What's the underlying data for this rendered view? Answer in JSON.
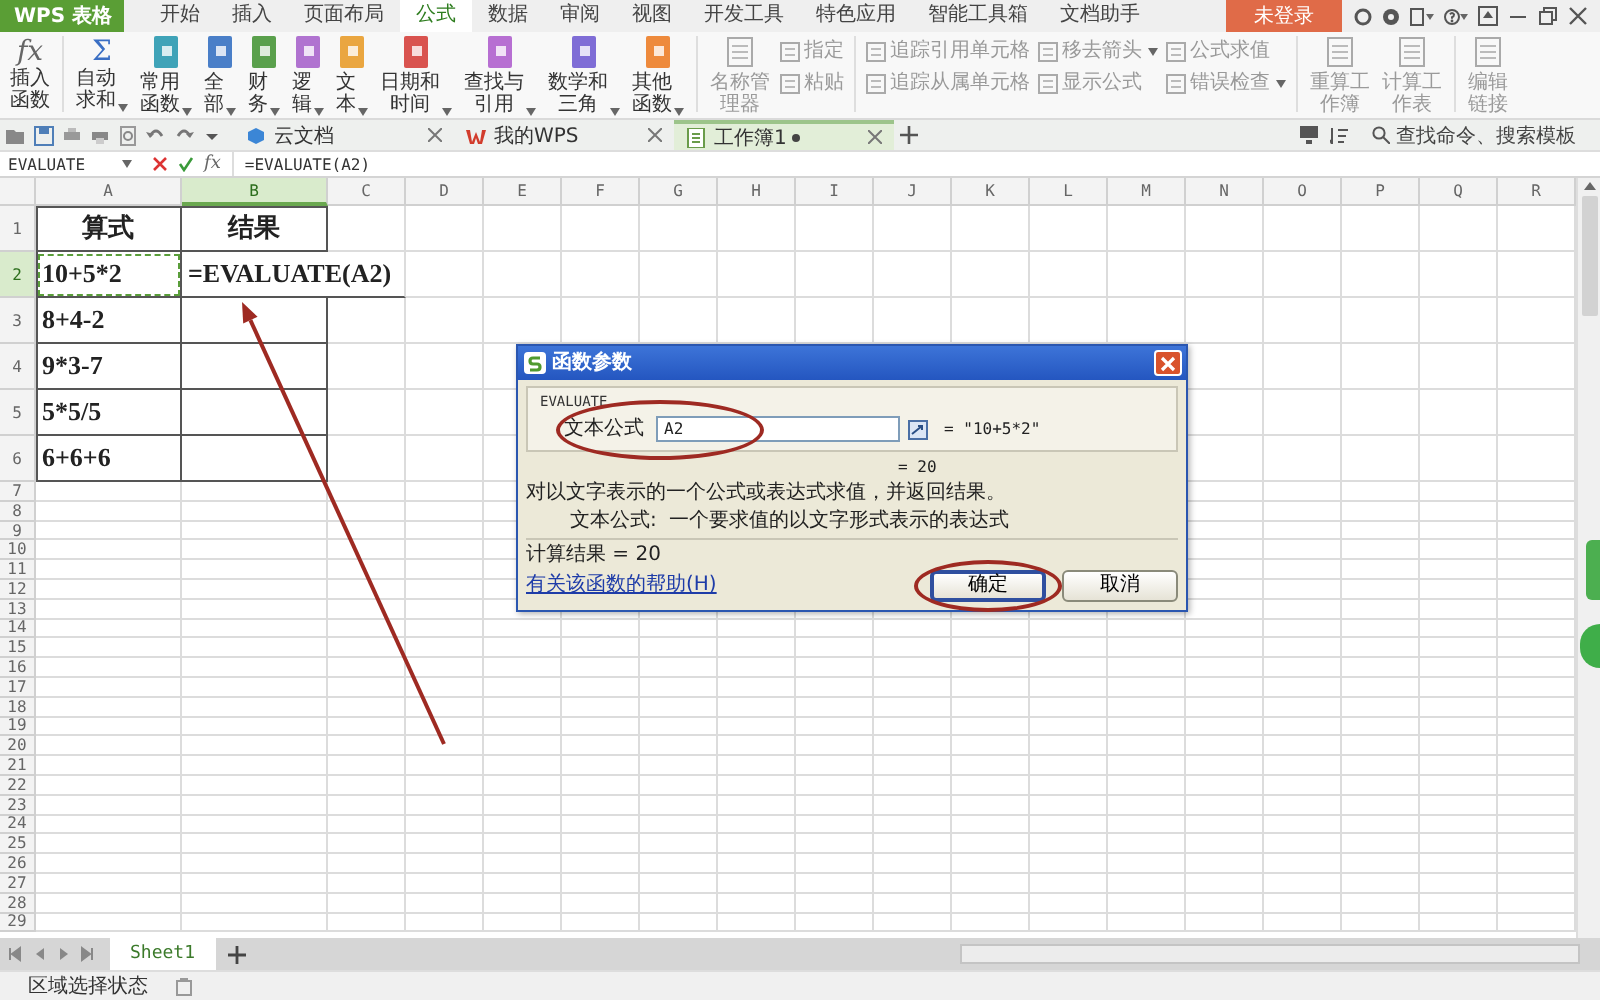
{
  "app": {
    "logo": "WPS 表格"
  },
  "menu_tabs": [
    {
      "label": "开始",
      "selected": false
    },
    {
      "label": "插入",
      "selected": false
    },
    {
      "label": "页面布局",
      "selected": false
    },
    {
      "label": "公式",
      "selected": true
    },
    {
      "label": "数据",
      "selected": false
    },
    {
      "label": "审阅",
      "selected": false
    },
    {
      "label": "视图",
      "selected": false
    },
    {
      "label": "开发工具",
      "selected": false
    },
    {
      "label": "特色应用",
      "selected": false
    },
    {
      "label": "智能工具箱",
      "selected": false
    },
    {
      "label": "文档助手",
      "selected": false
    }
  ],
  "login_button": "未登录",
  "ribbon": {
    "items": [
      {
        "kind": "glyph",
        "icon_text": "fx",
        "label": "插入函数",
        "dropdown": false,
        "disabled": false
      },
      {
        "kind": "separator"
      },
      {
        "kind": "glyph",
        "icon_text": "Σ",
        "label": "自动求和",
        "dropdown": true,
        "disabled": false
      },
      {
        "kind": "book",
        "color": "#3fa3b8",
        "label": "常用函数",
        "dropdown": true,
        "disabled": false
      },
      {
        "kind": "book",
        "color": "#4a7fc8",
        "label": "全部",
        "dropdown": true,
        "disabled": false
      },
      {
        "kind": "book",
        "color": "#5aa04c",
        "label": "财务",
        "dropdown": true,
        "disabled": false
      },
      {
        "kind": "book",
        "color": "#b073d0",
        "label": "逻辑",
        "dropdown": true,
        "disabled": false
      },
      {
        "kind": "book",
        "color": "#eaa640",
        "label": "文本",
        "dropdown": true,
        "disabled": false
      },
      {
        "kind": "book",
        "color": "#d9534f",
        "label": "日期和时间",
        "dropdown": true,
        "disabled": false
      },
      {
        "kind": "book",
        "color": "#b76fd2",
        "label": "查找与引用",
        "dropdown": true,
        "disabled": false
      },
      {
        "kind": "book",
        "color": "#7f6dd6",
        "label": "数学和三角",
        "dropdown": true,
        "disabled": false
      },
      {
        "kind": "book",
        "color": "#ee8a3c",
        "label": "其他函数",
        "dropdown": true,
        "disabled": false
      },
      {
        "kind": "separator"
      },
      {
        "kind": "tool",
        "label": "名称管理器",
        "dropdown": false,
        "disabled": true
      },
      {
        "kind": "stack",
        "disabled": true,
        "buttons": [
          {
            "label": "指定",
            "dropdown": false
          },
          {
            "label": "粘贴",
            "dropdown": false
          }
        ]
      },
      {
        "kind": "separator"
      },
      {
        "kind": "stack",
        "disabled": true,
        "buttons": [
          {
            "label": "追踪引用单元格",
            "dropdown": false
          },
          {
            "label": "追踪从属单元格",
            "dropdown": false
          }
        ]
      },
      {
        "kind": "stack",
        "disabled": true,
        "buttons": [
          {
            "label": "移去箭头",
            "dropdown": true
          },
          {
            "label": "显示公式",
            "dropdown": false
          }
        ]
      },
      {
        "kind": "stack",
        "disabled": true,
        "buttons": [
          {
            "label": "公式求值",
            "dropdown": false
          },
          {
            "label": "错误检查",
            "dropdown": true
          }
        ]
      },
      {
        "kind": "separator"
      },
      {
        "kind": "tool",
        "label": "重算工作簿",
        "dropdown": false,
        "disabled": true
      },
      {
        "kind": "tool",
        "label": "计算工作表",
        "dropdown": false,
        "disabled": true
      },
      {
        "kind": "separator"
      },
      {
        "kind": "tool",
        "label": "编辑链接",
        "dropdown": false,
        "disabled": true
      }
    ]
  },
  "doc_tabs": [
    {
      "label": "云文档",
      "selected": false,
      "unsaved": false
    },
    {
      "label": "我的WPS",
      "selected": false,
      "unsaved": false
    },
    {
      "label": "工作簿1",
      "selected": true,
      "unsaved": true
    }
  ],
  "command_search": {
    "placeholder": "查找命令、搜索模板"
  },
  "formula_bar": {
    "name_box": "EVALUATE",
    "fx": "fx",
    "formula": "=EVALUATE(A2)"
  },
  "grid": {
    "columns": [
      {
        "label": "A",
        "selected": false
      },
      {
        "label": "B",
        "selected": true
      },
      {
        "label": "C",
        "selected": false
      },
      {
        "label": "D",
        "selected": false
      },
      {
        "label": "E",
        "selected": false
      },
      {
        "label": "F",
        "selected": false
      },
      {
        "label": "G",
        "selected": false
      },
      {
        "label": "H",
        "selected": false
      },
      {
        "label": "I",
        "selected": false
      },
      {
        "label": "J",
        "selected": false
      },
      {
        "label": "K",
        "selected": false
      },
      {
        "label": "L",
        "selected": false
      },
      {
        "label": "M",
        "selected": false
      },
      {
        "label": "N",
        "selected": false
      },
      {
        "label": "O",
        "selected": false
      },
      {
        "label": "P",
        "selected": false
      },
      {
        "label": "Q",
        "selected": false
      },
      {
        "label": "R",
        "selected": false
      }
    ],
    "header_row": {
      "label": "1",
      "selected": false,
      "cells": [
        "算式",
        "结果"
      ]
    },
    "rows": [
      {
        "label": "2",
        "selected": true,
        "cells": [
          {
            "text": "10+5*2",
            "marquee": true
          },
          {
            "text": "=EVALUATE(A2)",
            "marquee": false
          }
        ]
      },
      {
        "label": "3",
        "selected": false,
        "cells": [
          {
            "text": "8+4-2",
            "marquee": false
          }
        ]
      },
      {
        "label": "4",
        "selected": false,
        "cells": [
          {
            "text": "9*3-7",
            "marquee": false
          }
        ]
      },
      {
        "label": "5",
        "selected": false,
        "cells": [
          {
            "text": "5*5/5",
            "marquee": false
          }
        ]
      },
      {
        "label": "6",
        "selected": false,
        "cells": [
          {
            "text": "6+6+6",
            "marquee": false
          }
        ]
      }
    ],
    "blank_rows": [
      "7",
      "8",
      "9",
      "10",
      "11",
      "12",
      "13",
      "14",
      "15",
      "16",
      "17",
      "18",
      "19",
      "20",
      "21",
      "22",
      "23",
      "24",
      "25",
      "26",
      "27",
      "28",
      "29"
    ]
  },
  "sheet_tabs": [
    {
      "label": "Sheet1",
      "selected": true
    }
  ],
  "status_bar": {
    "mode": "区域选择状态"
  },
  "dialog": {
    "title": "函数参数",
    "function_name": "EVALUATE",
    "argument": {
      "label": "文本公式",
      "value": "A2",
      "preview": "= \"10+5*2\""
    },
    "result_preview": "= 20",
    "description": "对以文字表示的一个公式或表达式求值，并返回结果。",
    "argument_help": {
      "label": "文本公式:",
      "text": "一个要求值的以文字形式表示的表达式"
    },
    "result": "计算结果 = 20",
    "help_link": "有关该函数的帮助(H)",
    "buttons": [
      {
        "label": "确定",
        "default": true
      },
      {
        "label": "取消",
        "default": false
      }
    ]
  }
}
